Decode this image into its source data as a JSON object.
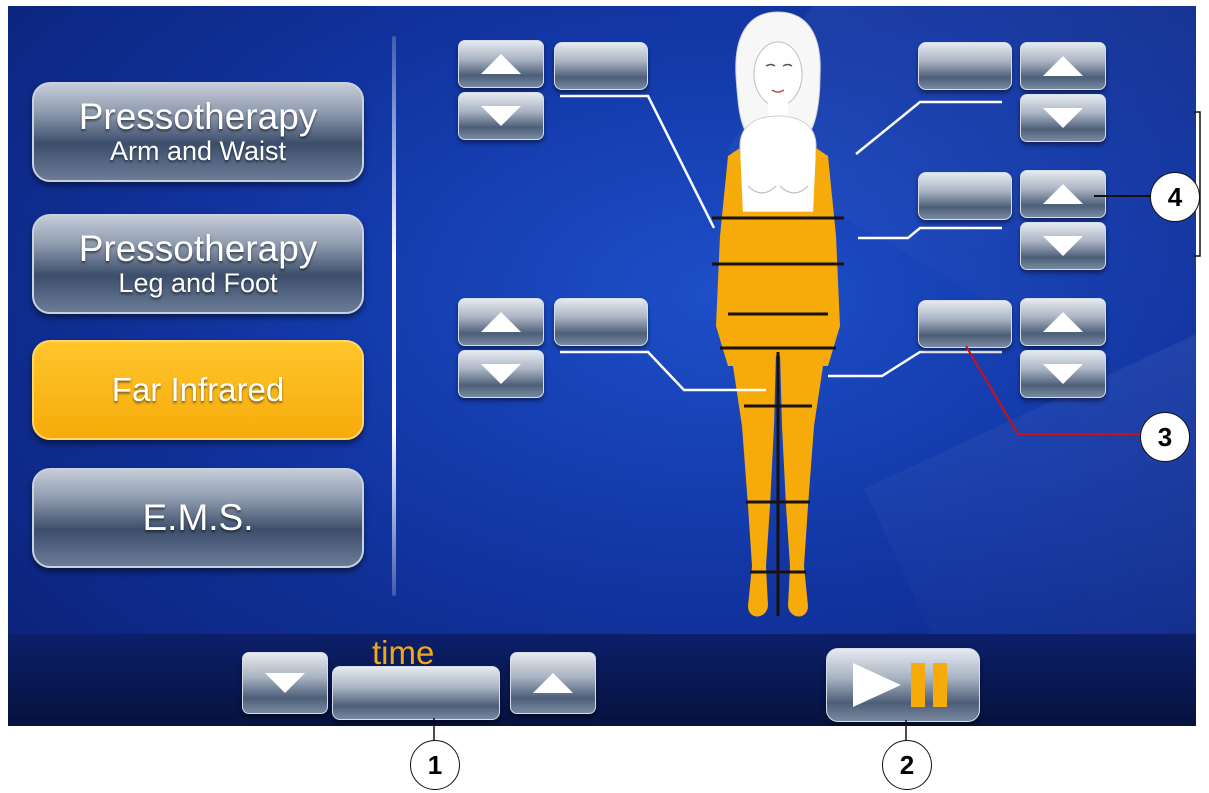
{
  "menu": [
    {
      "line1": "Pressotherapy",
      "line2": "Arm and Waist",
      "active": false
    },
    {
      "line1": "Pressotherapy",
      "line2": "Leg and Foot",
      "active": false
    },
    {
      "line1": "Far Infrared",
      "line2": "",
      "active": true
    },
    {
      "line1": "E.M.S.",
      "line2": "",
      "active": false
    }
  ],
  "time_control": {
    "label": "time"
  },
  "callouts": [
    "1",
    "2",
    "3",
    "4"
  ],
  "colors": {
    "accent": "#F6AB0A",
    "screen_bg": "#1236A4",
    "callout_line_red": "#D01010"
  }
}
